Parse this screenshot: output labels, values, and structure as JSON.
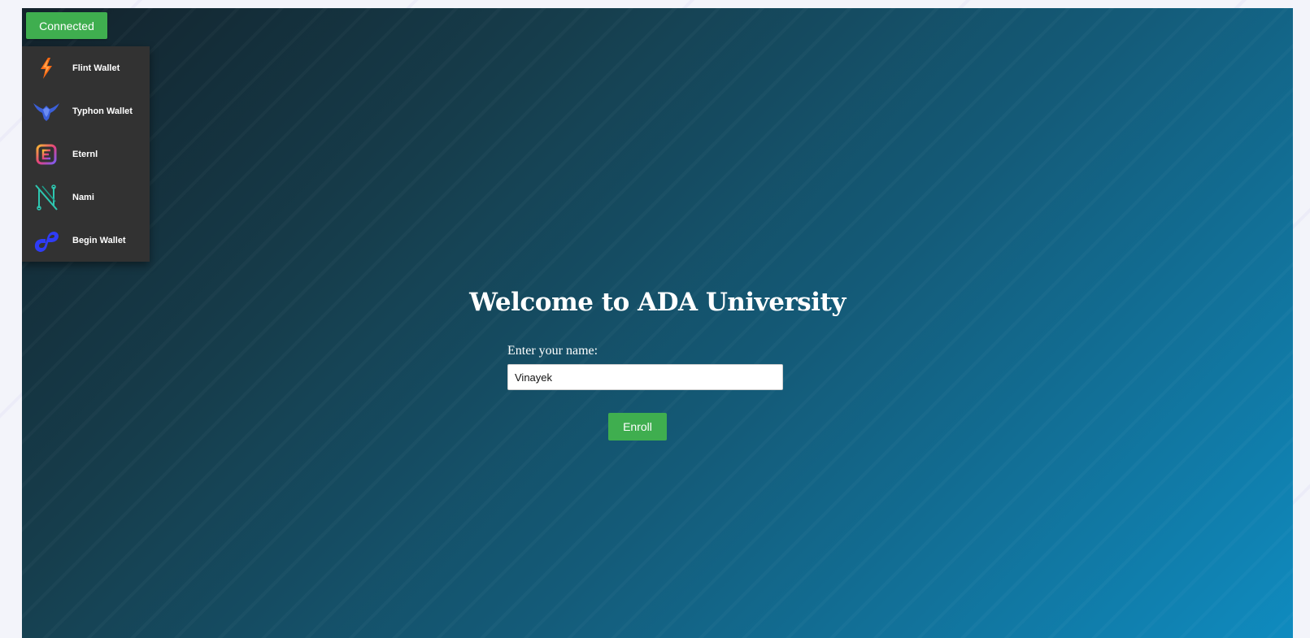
{
  "header": {
    "connect_button_label": "Connected"
  },
  "wallet_menu": {
    "items": [
      {
        "label": "Flint Wallet",
        "icon": "flint-icon"
      },
      {
        "label": "Typhon Wallet",
        "icon": "typhon-icon"
      },
      {
        "label": "Eternl",
        "icon": "eternl-icon"
      },
      {
        "label": "Nami",
        "icon": "nami-icon"
      },
      {
        "label": "Begin Wallet",
        "icon": "begin-icon"
      }
    ]
  },
  "main": {
    "title": "Welcome to ADA University",
    "name_label": "Enter your name:",
    "name_value": "Vinayek",
    "enroll_label": "Enroll"
  },
  "colors": {
    "accent_green": "#3fae4f",
    "menu_bg": "#323232"
  }
}
